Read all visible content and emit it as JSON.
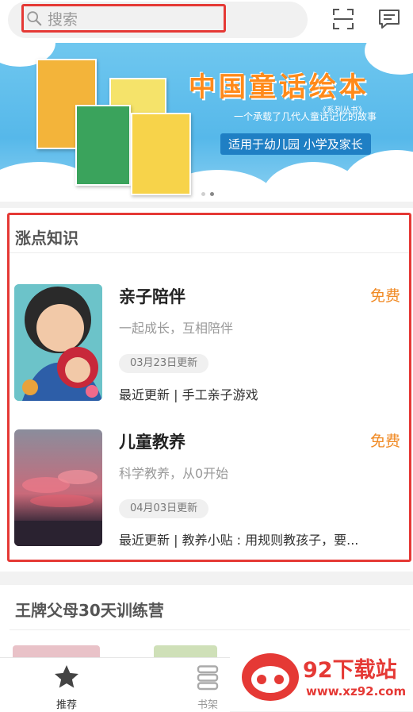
{
  "search": {
    "placeholder": "搜索"
  },
  "banner": {
    "title": "中国童话绘本",
    "series": "《系列丛书》",
    "subtitle": "一个承载了几代人童话记忆的故事",
    "audience": "适用于幼儿园 小学及家长"
  },
  "section1": {
    "title": "涨点知识",
    "items": [
      {
        "title": "亲子陪伴",
        "price": "免费",
        "desc": "一起成长，互相陪伴",
        "badge": "03月23日更新",
        "update": "最近更新 | 手工亲子游戏"
      },
      {
        "title": "儿童教养",
        "price": "免费",
        "desc": "科学教养，从0开始",
        "badge": "04月03日更新",
        "update": "最近更新 | 教养小贴 : 用规则教孩子，要..."
      }
    ]
  },
  "section2": {
    "title": "王牌父母30天训练营"
  },
  "nav": {
    "home_label": "推荐",
    "shelf_label": "书架"
  },
  "watermark": {
    "name": "92下载站",
    "url": "www.xz92.com"
  },
  "colors": {
    "highlight": "#e53935",
    "price": "#f08a24",
    "banner": "#5bbcec"
  }
}
